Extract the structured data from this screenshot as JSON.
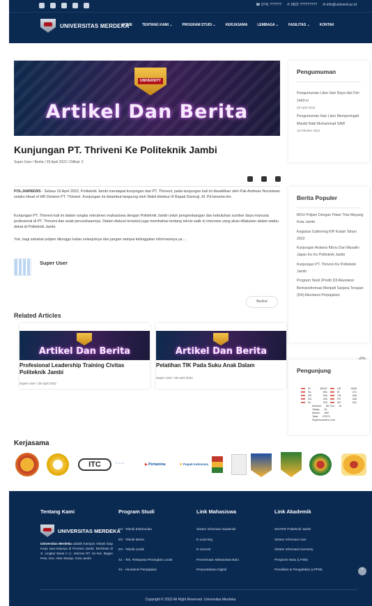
{
  "header": {
    "phone": "0741 ??????",
    "whatsapp": "0822 ?????????",
    "email": "info@unimerd.ac.id",
    "logo_text": "UNIVERSITAS MERDEKA",
    "menu": [
      "HOME",
      "TENTANG KAMI ⌄",
      "PROGRAM STUDI ⌄",
      "KERJASAMA",
      "LEMBAGA ⌄",
      "FASILITAS ⌄",
      "KONTAK"
    ]
  },
  "hero": {
    "badge_text": "UNIVERSITY",
    "title": "Artikel Dan Berita"
  },
  "article": {
    "title": "Kunjungan PT. Thriveni Ke Politeknik Jambi",
    "meta": "Super User  /  Berita  /  26 April 2022  /  Dilihat: 3",
    "lead": "POLJAMNEWS",
    "p1": " - Selasa 19 April 2022, Politeknik Jambi mendapat kunjungan dari PT. Thriveni, pada kunjungan kali ini diwakilkan oleh Pak Andreas Nurseiwan selaku Head of HR Division PT. Thriveni. Kunjungan ini disambut langsung oleh Wakil direktur III Bapak Darmuji, M. Pd beserta tim.",
    "p2": "Kunjungan PT. Thriveni kali ini dalam rangka rekrutmen mahasiswa dengan Politeknik Jambi untuk pengembangan dan kebutuhan sumber daya manusia profesional di PT. Thriveni dan anak perusahaannya. Dalam diskusi tersebut juga membahas tentang teknis walk in interview yang akan dilakukan dalam waktu dekat di Politeknik Jambi.",
    "p3": "Yuk, bagi sahabat poljam ditunggu kabar selanjutnya dan jangan sampai ketinggalan informasinya ya....",
    "author": "Super User",
    "next": "Berikut"
  },
  "related": {
    "heading": "Related Articles",
    "image_title": "Artikel Dan Berita",
    "items": [
      {
        "title": "Profesional Leadership Training Civitas Politeknik Jambi",
        "meta": "Super User  /  28 April 2022"
      },
      {
        "title": "Pelatihan TIK Pada Suku Anak Dalam",
        "meta": "Super User  /  28 April 2022"
      }
    ]
  },
  "sidebar": {
    "announcements_title": "Pengumuman",
    "announcements": [
      {
        "title": "Pengumuman Libur Hari Raya Idul Fitri 1443 H",
        "date": "28 April 2022"
      },
      {
        "title": "Pengumuman Hari Libur Memperingati Maulid Nabi Muhammad SAW",
        "date": "18 Oktober 2021"
      }
    ],
    "popular_title": "Berita Populer",
    "popular": [
      "MOU Poljam Dengan Pdam Tirta Mayang Kota Jambi",
      "Kegiatan Gathering KIP Kuliah Tahun 2022",
      "Kunjungan Aratana Kibou Dan Masaiki-Japan Inc Ke Politeknik Jambi",
      "Kunjungan PT. Thriveni Ke Politeknik Jambi",
      "Program Studi (Prodi) D3 Akuntansi Bertransformasi Menjadi Sarjana Terapan (D4) Akuntansi Perpajakan"
    ],
    "visitors_title": "Pengunjung",
    "visitors": {
      "rows": [
        {
          "c1": "ID",
          "n1": "85197",
          "c2": "US",
          "n2": "9006"
        },
        {
          "c1": "NL",
          "n1": "591",
          "c2": "IE",
          "n2": "471"
        },
        {
          "c1": "DE",
          "n1": "394",
          "c2": "CN",
          "n2": "345"
        },
        {
          "c1": "SG",
          "n1": "292",
          "c2": "FR",
          "n2": "235"
        },
        {
          "c1": "IN",
          "n1": "220",
          "c2": "MY",
          "n2": "151"
        }
      ],
      "newest_label": "Newest:",
      "newest_value": "KE You",
      "newest_count": "10",
      "today_label": "Today:",
      "today": "43",
      "month_label": "Month:",
      "month": "892",
      "total_label": "Total:",
      "total": "97973",
      "credit": "Supercounters.com"
    }
  },
  "kerjasama": {
    "heading": "Kerjasama",
    "partners": [
      "ITC",
      "Pertamina",
      "Pupuk Indonesia"
    ]
  },
  "footer": {
    "about_title": "Tentang Kami",
    "logo_text": "UNIVERSITAS MERDEKA",
    "about_bold": "Universitas Merdeka",
    "about_text": " adalah Kampus Vokasi Siap Kerja satu-satunya di Provinsi Jambi. Berlokasi di Jl. Lingkar Barat II Lr. Veteran RT. 04 Kel. Bagan Pete, Kec. Alam Barajo, Kota Jambi",
    "prodi_title": "Program Studi",
    "prodi": [
      "D3 - Teknik Elektronika",
      "D3 - Teknik Mesin",
      "D3 - Teknik Listrik",
      "S1 - Tek. Rekayasa Perangkat Lunak",
      "S1 - Akuntansi Perpajakan"
    ],
    "mhs_title": "Link Mahasiswa",
    "mhs": [
      "Sistem Informasi Akademik",
      "E-Learning",
      "E-Journal",
      "Penerimaan Mahasiswa Baru",
      "Perpustakaan Digital"
    ],
    "akad_title": "Link Akademik",
    "akad": [
      "SISTER Politeknik Jambi",
      "Sistem Informasi Aset",
      "Sistem Informasi Inventory",
      "Penjamin Mutu (LP3M)",
      "Penelitian & Pengabdian (LPPM)"
    ],
    "copyright": "Copyright © 2022 All Right Reserved. Universitas Merdeka"
  },
  "colors": {
    "navy": "#0b2a52",
    "accent": "#b1121c"
  }
}
